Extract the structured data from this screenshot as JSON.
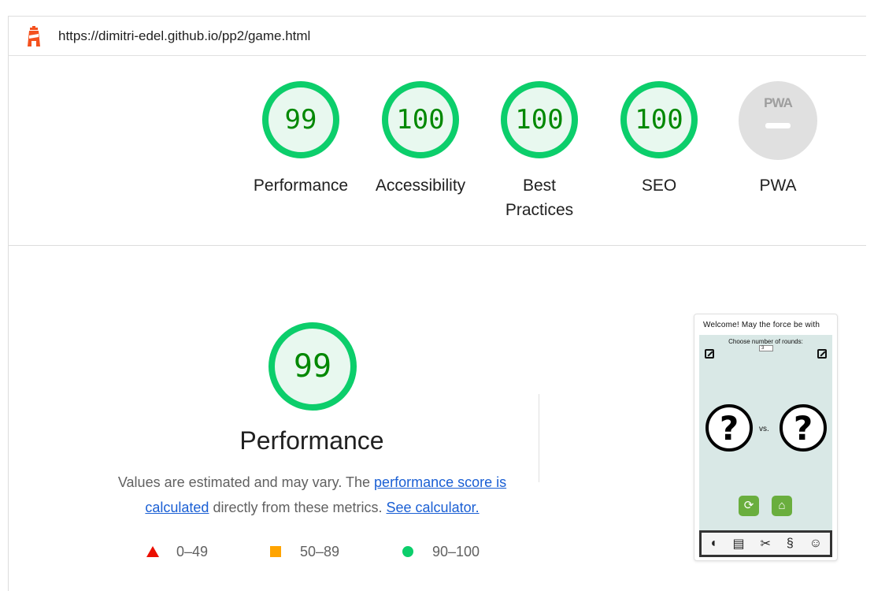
{
  "header": {
    "url": "https://dimitri-edel.github.io/pp2/game.html",
    "logo_icon": "lighthouse-icon"
  },
  "scores": [
    {
      "label": "Performance",
      "value": "99",
      "score": 99
    },
    {
      "label": "Accessibility",
      "value": "100",
      "score": 100
    },
    {
      "label": "Best Practices",
      "value": "100",
      "score": 100
    },
    {
      "label": "SEO",
      "value": "100",
      "score": 100
    },
    {
      "label": "PWA",
      "badge_text": "PWA"
    }
  ],
  "performance": {
    "score": "99",
    "score_value": 99,
    "title": "Performance",
    "desc_part1": "Values are estimated and may vary. The ",
    "score_link": "performance score is calculated",
    "desc_part2": " directly from these metrics. ",
    "calculator_link": "See calculator."
  },
  "legend": [
    {
      "range": "0–49",
      "shape": "triangle",
      "color": "#eb0f00"
    },
    {
      "range": "50–89",
      "shape": "square",
      "color": "#ffa400"
    },
    {
      "range": "90–100",
      "shape": "circle",
      "color": "#0cce6b"
    }
  ],
  "thumbnail": {
    "title": "Welcome! May the force be with",
    "rounds_label": "Choose number of rounds:",
    "rounds_value": "3",
    "vs": "vs.",
    "player_choice": "?",
    "computer_choice": "?"
  },
  "colors": {
    "pass_green": "#0cce6b",
    "pass_text": "#008800",
    "pass_fill": "#e8f8ef",
    "link": "#1a5fd4"
  }
}
